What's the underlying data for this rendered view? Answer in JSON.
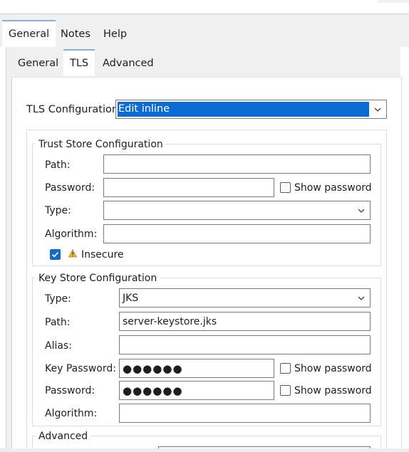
{
  "outer_tabs": [
    {
      "label": "General",
      "active": true
    },
    {
      "label": "Notes",
      "active": false
    },
    {
      "label": "Help",
      "active": false
    }
  ],
  "inner_tabs": [
    {
      "label": "General",
      "active": false
    },
    {
      "label": "TLS",
      "active": true
    },
    {
      "label": "Advanced",
      "active": false
    }
  ],
  "tls": {
    "config_label": "TLS Configuration",
    "config_value": "Edit inline"
  },
  "trust_store": {
    "title": "Trust Store Configuration",
    "path_label": "Path:",
    "path_value": "",
    "password_label": "Password:",
    "password_value": "",
    "show_password_label": "Show password",
    "show_password_checked": false,
    "type_label": "Type:",
    "type_value": "",
    "algorithm_label": "Algorithm:",
    "algorithm_value": "",
    "insecure_label": "Insecure",
    "insecure_checked": true
  },
  "key_store": {
    "title": "Key Store Configuration",
    "type_label": "Type:",
    "type_value": "JKS",
    "path_label": "Path:",
    "path_value": "server-keystore.jks",
    "alias_label": "Alias:",
    "alias_value": "",
    "key_password_label": "Key Password:",
    "key_password_value": "●●●●●●",
    "key_show_password_label": "Show password",
    "key_show_password_checked": false,
    "password_label": "Password:",
    "password_value": "●●●●●●",
    "show_password_label": "Show password",
    "show_password_checked": false,
    "algorithm_label": "Algorithm:",
    "algorithm_value": ""
  },
  "advanced_section": {
    "title": "Advanced"
  },
  "colors": {
    "selection": "#0d6bd7",
    "checkbox_checked": "#1668c5",
    "tab_accent": "#7fb2e1",
    "warning": "#e6a817"
  }
}
